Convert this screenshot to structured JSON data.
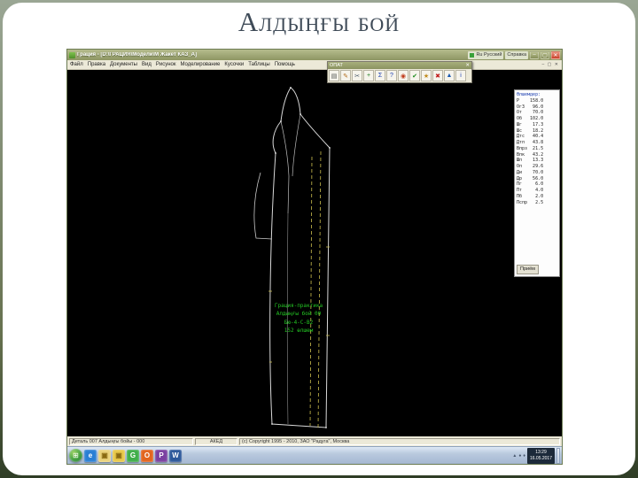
{
  "slide": {
    "title": "Алдыңғы бой"
  },
  "window": {
    "title": "Грация - [D:\\ГРАЦИЯ\\Модели\\М Жакет КАЗ_А]",
    "lang": "Ru Русский",
    "help": "Справка",
    "controls": {
      "min": "–",
      "max": "▢",
      "close": "✕"
    },
    "child_controls": "– ▢ ✕",
    "menu": [
      "Файл",
      "Правка",
      "Документы",
      "Вид",
      "Рисунок",
      "Моделирование",
      "Кусочки",
      "Таблицы",
      "Помощь"
    ]
  },
  "palette": {
    "title": "ОПАТ",
    "close": "✕",
    "icons": [
      {
        "g": "▤",
        "fg": "#555555"
      },
      {
        "g": "✎",
        "fg": "#b06a1a"
      },
      {
        "g": "✂",
        "fg": "#4a5a6a"
      },
      {
        "g": "+",
        "fg": "#1a7a1a"
      },
      {
        "g": "Σ",
        "fg": "#1a3db0"
      },
      {
        "g": "?",
        "fg": "#1a3db0"
      },
      {
        "g": "◉",
        "fg": "#c03a1a"
      },
      {
        "g": "✔",
        "fg": "#1a8a1a"
      },
      {
        "g": "★",
        "fg": "#c08a1a"
      },
      {
        "g": "✖",
        "fg": "#c01a1a"
      },
      {
        "g": "▲",
        "fg": "#1a5ab0"
      },
      {
        "g": "i",
        "fg": "#1a3db0"
      }
    ]
  },
  "pattern": {
    "label_lines": [
      "Грация-практика",
      "Алдыңғы бой 00",
      "Бю-4-С-В2",
      "152 өлшем"
    ],
    "colors": {
      "outline": "#d9d9d9",
      "dashed": "#cdbf4e",
      "label": "#23c523",
      "background": "#000000"
    }
  },
  "panel": {
    "lines": [
      "Өлшемдер:",
      "Р    158.0",
      "Ог3   96.0",
      "От    70.0",
      "Об   102.0",
      "Шг    17.3",
      "Шс    18.2",
      "Дтс   40.4",
      "Дтп   43.8",
      "Впрз  21.5",
      "Впк   43.2",
      "Шп    13.3",
      "Оп    29.6",
      "Ди    70.0",
      "Др    56.0",
      "Пг     6.0",
      "Пт     4.0",
      "Пб     2.0",
      "Пспр   2.5"
    ],
    "button": "Приём"
  },
  "statusbar": {
    "left": "Деталь 007 Алдыңғы бойы - 000",
    "mid": "АКЕД",
    "right": "(c) Copyright 1995 - 2010, ЗАО \"Радуга\", Москва"
  },
  "taskbar": {
    "start": "⊞",
    "icons": [
      {
        "g": "e",
        "bg": "#2a7fd4",
        "fg": "#ffffff"
      },
      {
        "g": "▣",
        "bg": "#ead27a",
        "fg": "#8a6a10"
      },
      {
        "g": "▣",
        "bg": "#e8c84a",
        "fg": "#8a6a10"
      },
      {
        "g": "G",
        "bg": "#3fae49",
        "fg": "#ffffff"
      },
      {
        "g": "O",
        "bg": "#e2641e",
        "fg": "#ffffff"
      },
      {
        "g": "P",
        "bg": "#7a3fa0",
        "fg": "#ffffff"
      },
      {
        "g": "W",
        "bg": "#2b579a",
        "fg": "#ffffff"
      }
    ],
    "tray_icons": [
      "▲",
      "●",
      "♦"
    ],
    "time": "13:29",
    "date": "16.05.2017"
  }
}
